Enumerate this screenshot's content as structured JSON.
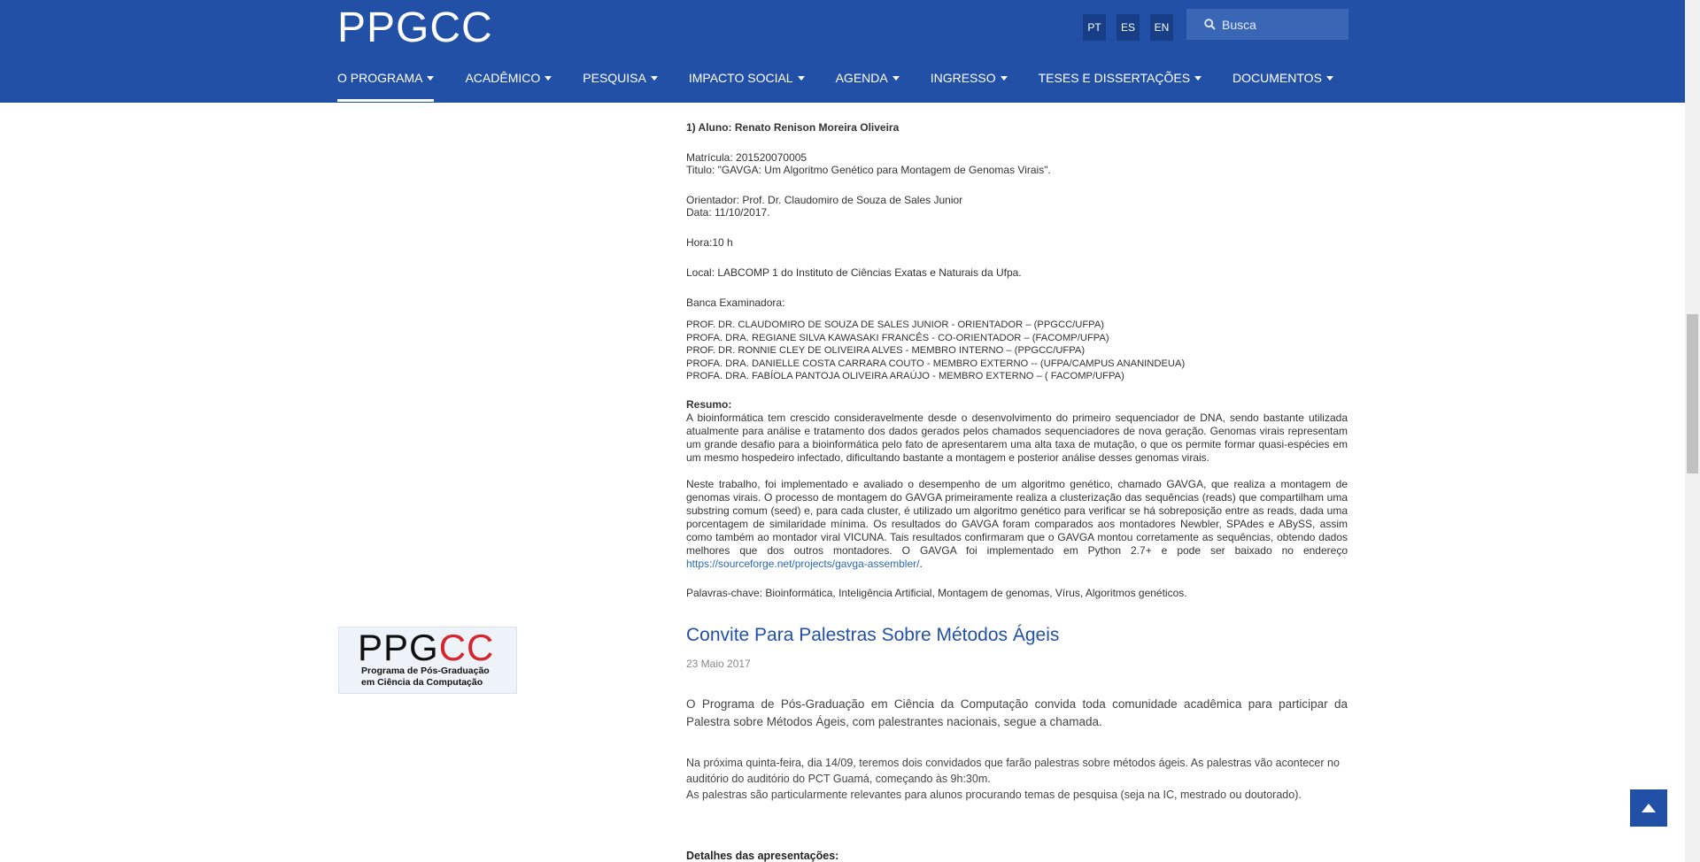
{
  "header": {
    "logo": "PPGCC",
    "langs": [
      "PT",
      "ES",
      "EN"
    ],
    "search_placeholder": "Busca",
    "nav": [
      {
        "label": "O PROGRAMA"
      },
      {
        "label": "ACADÊMICO"
      },
      {
        "label": "PESQUISA"
      },
      {
        "label": "IMPACTO SOCIAL"
      },
      {
        "label": "AGENDA"
      },
      {
        "label": "INGRESSO"
      },
      {
        "label": "TESES E DISSERTAÇÕES"
      },
      {
        "label": "DOCUMENTOS"
      }
    ]
  },
  "defense": {
    "heading": "1) Aluno: Renato Renison Moreira Oliveira",
    "matricula": "Matrícula: 201520070005",
    "titulo": "Titulo: \"GAVGA: Um Algoritmo Genético para Montagem de Genomas Virais\".",
    "orientador": "Orientador: Prof. Dr. Claudomiro de Souza de Sales Junior",
    "data": "Data: 11/10/2017.",
    "hora": "Hora:10 h",
    "local": "Local: LABCOMP 1 do Instituto de Ciências Exatas e Naturais da Ufpa.",
    "banca_label": "Banca Examinadora:",
    "banca": [
      "PROF. DR. CLAUDOMIRO DE SOUZA DE SALES JUNIOR - ORIENTADOR – (PPGCC/UFPA)",
      "PROFA. DRA. REGIANE SILVA KAWASAKI FRANCÊS - CO-ORIENTADOR – (FACOMP/UFPA)",
      "PROF. DR. RONNIE CLEY DE OLIVEIRA ALVES - MEMBRO INTERNO – (PPGCC/UFPA)",
      "PROFA. DRA. DANIELLE COSTA CARRARA COUTO - MEMBRO EXTERNO -- (UFPA/CAMPUS ANANINDEUA)",
      "PROFA. DRA. FABÍOLA PANTOJA OLIVEIRA ARAÚJO - MEMBRO EXTERNO – ( FACOMP/UFPA)"
    ],
    "resumo_label": "Resumo:",
    "resumo_p1": "A bioinformática tem crescido consideravelmente desde o desenvolvimento do primeiro sequenciador de DNA, sendo bastante utilizada atualmente para análise e tratamento dos dados gerados pelos chamados sequenciadores de nova geração. Genomas virais representam um grande desafio para a bioinformática pelo fato de apresentarem uma alta taxa de mutação, o que os permite formar quasi-espécies em um mesmo hospedeiro infectado, dificultando bastante a montagem e posterior análise desses genomas virais.",
    "resumo_p2": "Neste trabalho, foi implementado e avaliado o desempenho de um algoritmo genético, chamado GAVGA, que realiza a montagem de genomas virais. O processo de montagem do GAVGA primeiramente realiza a clusterização das sequências (reads) que compartilham uma substring comum (seed) e, para cada cluster, é utilizado um algoritmo genético para verificar se há sobreposição entre as reads, dada uma porcentagem de similaridade mínima. Os resultados do GAVGA foram comparados aos montadores Newbler, SPAdes e ABySS, assim como também ao montador viral VICUNA. Tais resultados confirmaram que o GAVGA montou corretamente as sequências, obtendo dados melhores que dos outros montadores. O GAVGA foi implementado em Python 2.7+ e pode ser baixado no endereço ",
    "resumo_link": "https://sourceforge.net/projects/gavga-assembler/",
    "resumo_end": ".",
    "keywords": "Palavras-chave: Bioinformática, Inteligência Artificial, Montagem de genomas, Vírus, Algoritmos genéticos."
  },
  "sidebar_logo": {
    "big_black": "PPG",
    "big_red": "CC",
    "line1": "Programa de Pós-Graduação",
    "line2": "em Ciência da Computação"
  },
  "article": {
    "title": "Convite Para Palestras Sobre Métodos Ágeis",
    "date": "23 Maio 2017",
    "p1": "O Programa de Pós-Graduação em Ciência da Computação convida toda comunidade acadêmica para participar da Palestra sobre Métodos Ágeis, com palestrantes nacionais, segue a chamada.",
    "p2_line1": "Na próxima quinta-feira, dia 14/09, teremos dois convidados que farão palestras sobre métodos ágeis. As palestras vão acontecer no auditório do auditório do PCT Guamá, começando às 9h:30m.",
    "p2_line2": "As palestras são particularmente relevantes para alunos procurando temas de pesquisa (seja na IC, mestrado ou doutorado).",
    "details_heading": "Detalhes das apresentações:"
  },
  "icons": {
    "search": "search-icon",
    "back_to_top": "arrow-up-icon"
  }
}
